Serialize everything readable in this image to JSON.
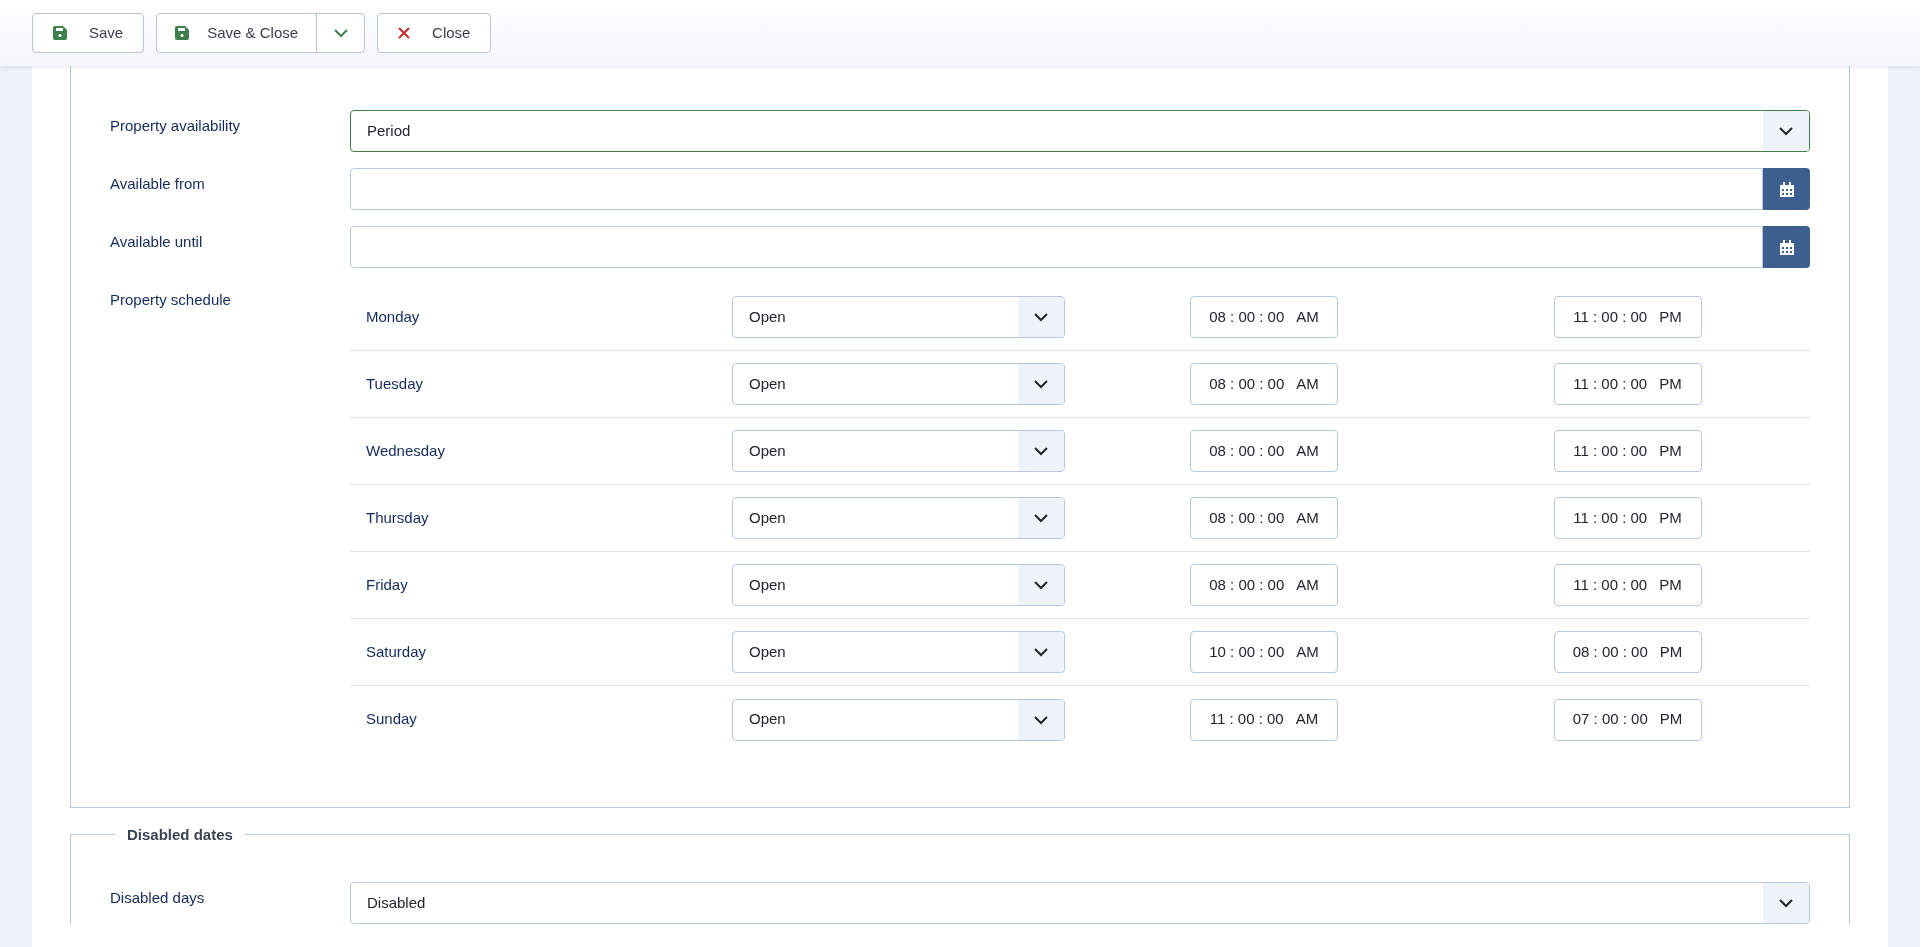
{
  "toolbar": {
    "buttons": [
      {
        "kind": "save",
        "label": "Save",
        "dropdown": false
      },
      {
        "kind": "save",
        "label": "Save & Close",
        "dropdown": true
      },
      {
        "kind": "close",
        "label": "Close",
        "dropdown": false
      }
    ]
  },
  "availability": {
    "fields": [
      {
        "kind": "select",
        "label": "Property availability",
        "value": "Period",
        "valid": true
      },
      {
        "kind": "date",
        "label": "Available from"
      },
      {
        "kind": "date",
        "label": "Available until"
      }
    ],
    "schedule": {
      "label": "Property schedule",
      "days": [
        {
          "day": "Monday",
          "status": "Open",
          "open": {
            "time": "08 : 00 : 00",
            "period": "AM"
          },
          "close": {
            "time": "11 : 00 : 00",
            "period": "PM"
          }
        },
        {
          "day": "Tuesday",
          "status": "Open",
          "open": {
            "time": "08 : 00 : 00",
            "period": "AM"
          },
          "close": {
            "time": "11 : 00 : 00",
            "period": "PM"
          }
        },
        {
          "day": "Wednesday",
          "status": "Open",
          "open": {
            "time": "08 : 00 : 00",
            "period": "AM"
          },
          "close": {
            "time": "11 : 00 : 00",
            "period": "PM"
          }
        },
        {
          "day": "Thursday",
          "status": "Open",
          "open": {
            "time": "08 : 00 : 00",
            "period": "AM"
          },
          "close": {
            "time": "11 : 00 : 00",
            "period": "PM"
          }
        },
        {
          "day": "Friday",
          "status": "Open",
          "open": {
            "time": "08 : 00 : 00",
            "period": "AM"
          },
          "close": {
            "time": "11 : 00 : 00",
            "period": "PM"
          }
        },
        {
          "day": "Saturday",
          "status": "Open",
          "open": {
            "time": "10 : 00 : 00",
            "period": "AM"
          },
          "close": {
            "time": "08 : 00 : 00",
            "period": "PM"
          }
        },
        {
          "day": "Sunday",
          "status": "Open",
          "open": {
            "time": "11 : 00 : 00",
            "period": "AM"
          },
          "close": {
            "time": "07 : 00 : 00",
            "period": "PM"
          }
        }
      ]
    }
  },
  "disabled_dates": {
    "legend": "Disabled dates",
    "fields": [
      {
        "kind": "select",
        "label": "Disabled days",
        "value": "Disabled",
        "valid": false
      }
    ]
  }
}
